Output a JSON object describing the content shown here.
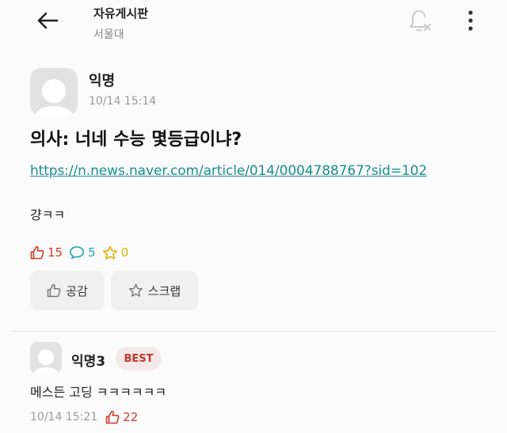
{
  "header": {
    "board_name": "자유게시판",
    "school_name": "서울대",
    "icons": {
      "back": "back-arrow-icon",
      "bell": "bell-off-icon",
      "more": "more-vertical-icon"
    }
  },
  "post": {
    "author": "익명",
    "time": "10/14 15:14",
    "title": "의사: 너네 수능 몇등급이냐?",
    "link": "https://n.news.naver.com/article/014/0004788767?sid=102",
    "body": "걍ㅋㅋ",
    "likes": "15",
    "comments": "5",
    "scraps": "0",
    "actions": {
      "like_label": "공감",
      "scrap_label": "스크랩"
    }
  },
  "comment": {
    "author": "익명3",
    "badge": "BEST",
    "body": "메스든 고딩 ㅋㅋㅋㅋㅋㅋ",
    "time": "10/14 15:21",
    "likes": "22"
  },
  "colors": {
    "like": "#d03a2a",
    "comment": "#1aa0c0",
    "scrap": "#e0b000",
    "link": "#1a8f8f",
    "best_bg": "#f3e9e8",
    "best_text": "#c0392b"
  }
}
